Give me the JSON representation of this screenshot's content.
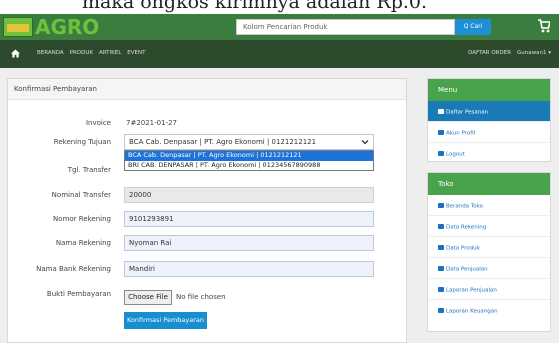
{
  "caption": "maka ongkos kirimnya adalah Rp.0.",
  "logo": {
    "word": "AGRO"
  },
  "search": {
    "placeholder": "Kolom Pencarian Produk",
    "button_label": "Q Cari"
  },
  "nav": {
    "links": [
      "BERANDA",
      "PRODUK",
      "ARTIKEL",
      "EVENT"
    ],
    "orders": "DAFTAR ORDER",
    "user": "Gunawan1 ▾"
  },
  "form": {
    "title": "Konfirmasi Pembayaran",
    "invoice_label": "Invoice",
    "invoice_value": "7#2021-01-27",
    "rekening_label": "Rekening Tujuan",
    "rekening_selected": "BCA Cab. Denpasar | PT. Agro Ekonomi | 0121212121",
    "rekening_options": [
      "BCA Cab. Denpasar | PT. Agro Ekonomi | 0121212121",
      "BRI CAB. DENPASAR | PT. Agro Ekonomi | 01234567890988"
    ],
    "tgl_label": "Tgl. Transfer",
    "nominal_label": "Nominal Transfer",
    "nominal_value": "20000",
    "nomor_label": "Nomor Rekening",
    "nomor_value": "9101293891",
    "nama_label": "Nama Rekening",
    "nama_value": "Nyoman Rai",
    "bank_label": "Nama Bank Rekening",
    "bank_value": "Mandiri",
    "bukti_label": "Bukti Pembayaran",
    "file_button": "Choose File",
    "file_status": "No file chosen",
    "submit_label": "Konfirmasi Pembayaran"
  },
  "menu": {
    "title": "Menu",
    "items": [
      "Daftar Pesanan",
      "Akun Profil",
      "Logout"
    ]
  },
  "toko": {
    "title": "Toko",
    "items": [
      "Beranda Toko",
      "Data Rekening",
      "Data Produk",
      "Data Penjualan",
      "Laporan Penjualan",
      "Laporan Keuangan"
    ]
  },
  "colors": {
    "topbar": "#3a7d3f",
    "navbar": "#2e4a2d",
    "accent": "#168ed0",
    "side_head": "#48a34c"
  }
}
